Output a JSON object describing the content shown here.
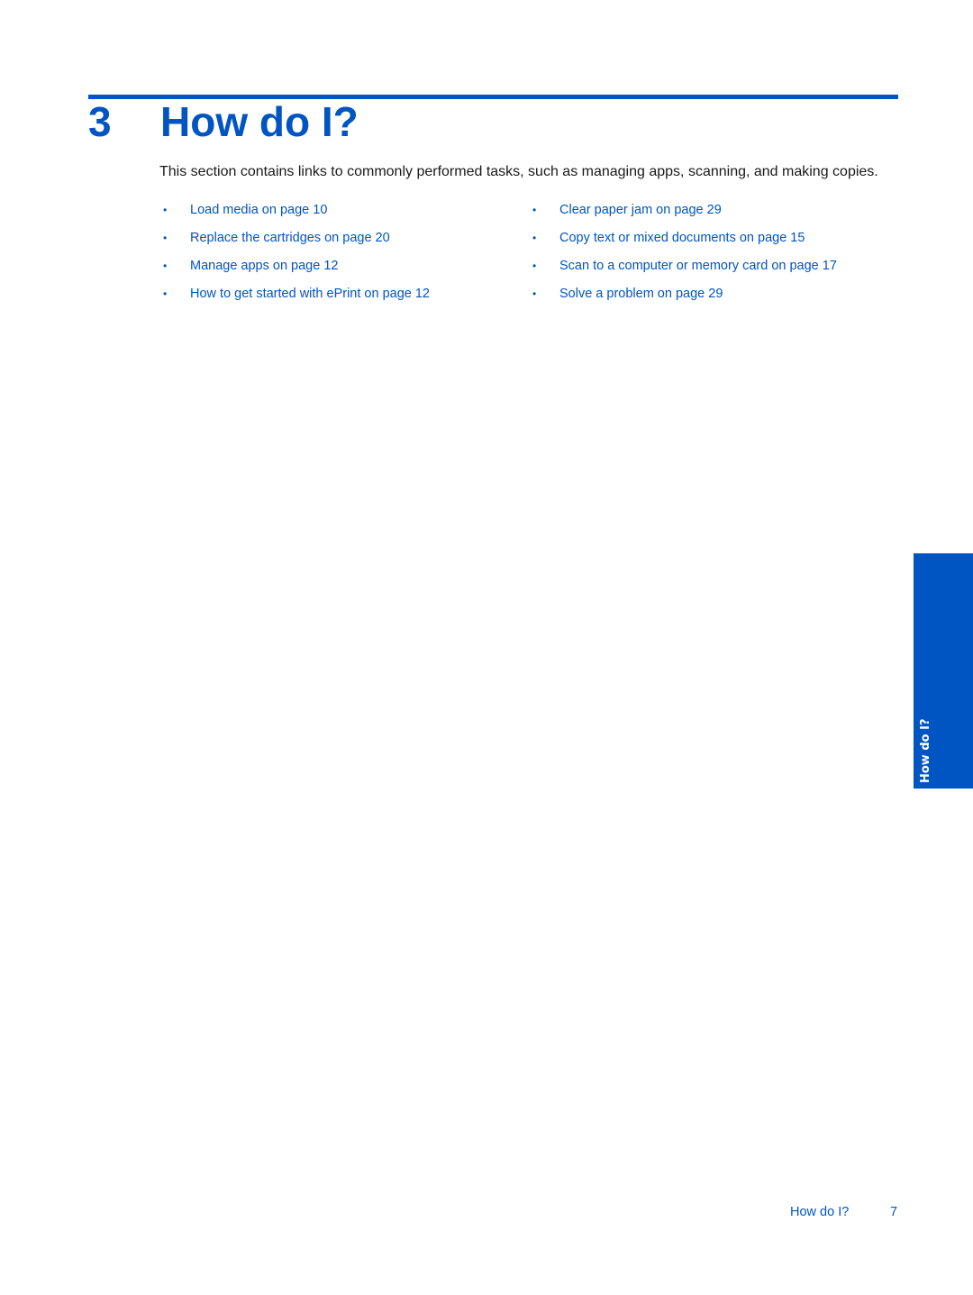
{
  "chapter": {
    "number": "3",
    "title": "How do I?"
  },
  "intro": "This section contains links to commonly performed tasks, such as managing apps, scanning, and making copies.",
  "links": {
    "left": [
      {
        "label": "Load media on page 10"
      },
      {
        "label": "Replace the cartridges on page 20"
      },
      {
        "label": "Manage apps on page 12"
      },
      {
        "label": "How to get started with ePrint on page 12"
      }
    ],
    "right": [
      {
        "label": "Clear paper jam on page 29"
      },
      {
        "label": "Copy text or mixed documents on page 15"
      },
      {
        "label": "Scan to a computer or memory card on page 17"
      },
      {
        "label": "Solve a problem on page 29"
      }
    ],
    "bullet": "•"
  },
  "side_tab": {
    "label": "How do I?"
  },
  "footer": {
    "title": "How do I?",
    "page_number": "7"
  },
  "colors": {
    "accent": "#0055c2",
    "text": "#1a1a1a"
  }
}
